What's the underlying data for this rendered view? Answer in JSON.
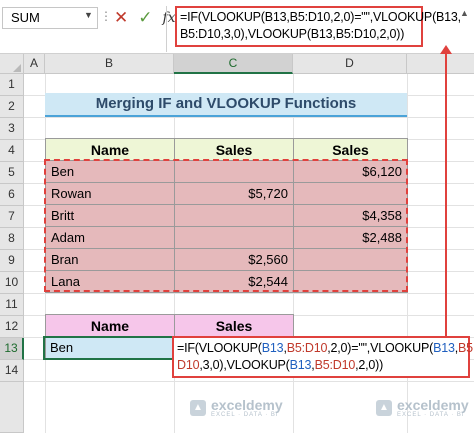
{
  "formula_bar": {
    "name_box": "SUM",
    "dots": "⋮",
    "cancel_icon": "✕",
    "enter_icon": "✓",
    "fx_label": "fx",
    "formula_line1": "=IF(VLOOKUP(B13,B5:D10,2,0)=\"\",VLOOKUP(B13,",
    "formula_line2": "B5:D10,3,0),VLOOKUP(B13,B5:D10,2,0))"
  },
  "columns": [
    "A",
    "B",
    "C",
    "D"
  ],
  "rows": [
    "1",
    "2",
    "3",
    "4",
    "5",
    "6",
    "7",
    "8",
    "9",
    "10",
    "11",
    "12",
    "13",
    "14"
  ],
  "title": "Merging IF and VLOOKUP Functions",
  "table": {
    "headers": [
      "Name",
      "Sales",
      "Sales"
    ],
    "rows": [
      {
        "name": "Ben",
        "c": "",
        "d": "$6,120"
      },
      {
        "name": "Rowan",
        "c": "$5,720",
        "d": ""
      },
      {
        "name": "Britt",
        "c": "",
        "d": "$4,358"
      },
      {
        "name": "Adam",
        "c": "",
        "d": "$2,488"
      },
      {
        "name": "Bran",
        "c": "$2,560",
        "d": ""
      },
      {
        "name": "Lana",
        "c": "$2,544",
        "d": ""
      }
    ]
  },
  "lookup": {
    "headers": [
      "Name",
      "Sales"
    ],
    "name": "Ben"
  },
  "cell_formula": {
    "p1": "=IF(VLOOKUP(",
    "r1": "B13",
    "p2": ",",
    "r2": "B5:D10",
    "p3": ",2,0)=\"\",VLOOKUP(",
    "r3": "B13",
    "p4": ",",
    "r4": "B5:",
    "p5": "D10",
    "p6": ",3,0),VLOOKUP(",
    "r5": "B13",
    "p7": ",",
    "r6": "B5:D10",
    "p8": ",2,0))"
  },
  "watermark": {
    "name": "exceldemy",
    "sub": "EXCEL · DATA · BI"
  }
}
